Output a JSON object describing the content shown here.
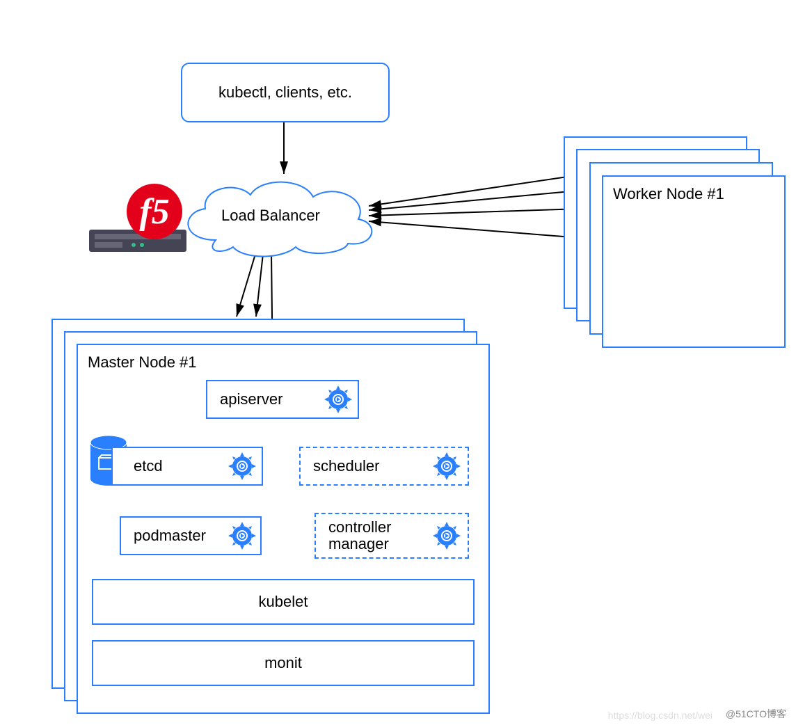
{
  "clients_box": {
    "label": "kubectl, clients, etc."
  },
  "load_balancer": {
    "label": "Load Balancer"
  },
  "f5": {
    "label": "f5"
  },
  "master": {
    "title": "Master Node #1",
    "apiserver": "apiserver",
    "etcd": "etcd",
    "scheduler": "scheduler",
    "podmaster": "podmaster",
    "controller_manager": "controller\nmanager",
    "kubelet": "kubelet",
    "monit": "monit"
  },
  "worker": {
    "title": "Worker Node #1"
  },
  "watermark": {
    "text1": "https://blog.csdn.net/wei",
    "text2": "@51CTO博客"
  },
  "colors": {
    "blue": "#2a7fff",
    "red": "#e2001a",
    "fill_blue": "#2a7fff"
  }
}
